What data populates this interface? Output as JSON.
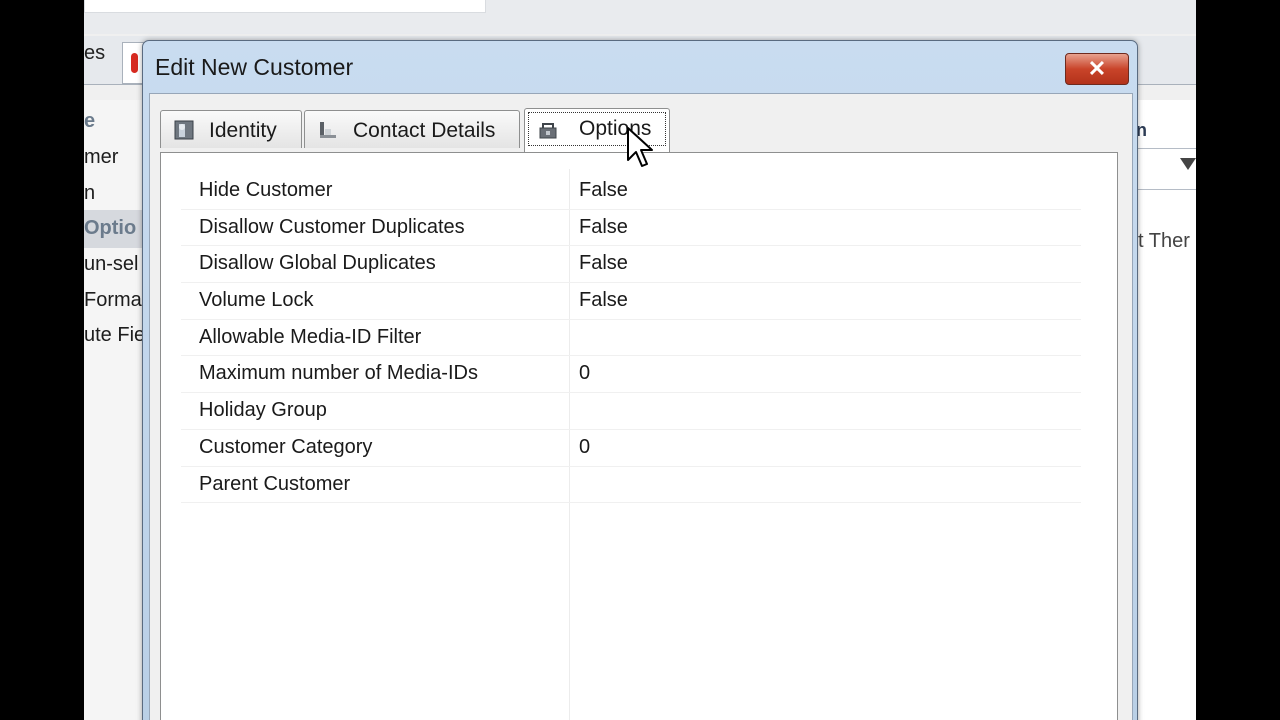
{
  "background_app": {
    "partial_tab_text": "es",
    "left_list": [
      {
        "text": "e",
        "header": true
      },
      {
        "text": "mer",
        "header": false
      },
      {
        "text": "n",
        "header": false
      },
      {
        "text": "Optio",
        "header": true
      },
      {
        "text": "un-sel",
        "header": false
      },
      {
        "text": "Forma",
        "header": false
      },
      {
        "text": "ute Fie",
        "header": false
      }
    ],
    "right_partial_text": "t Ther",
    "right_header_text": "n"
  },
  "dialog": {
    "title": "Edit New Customer",
    "close_label": "✕",
    "tabs": [
      {
        "label": "Identity",
        "icon": "identity-icon",
        "active": false
      },
      {
        "label": "Contact Details",
        "icon": "contact-details-icon",
        "active": false
      },
      {
        "label": "Options",
        "icon": "options-icon",
        "active": true
      }
    ],
    "properties": [
      {
        "name": "Hide Customer",
        "value": "False"
      },
      {
        "name": "Disallow Customer Duplicates",
        "value": "False"
      },
      {
        "name": "Disallow Global Duplicates",
        "value": "False"
      },
      {
        "name": "Volume Lock",
        "value": "False"
      },
      {
        "name": "Allowable Media-ID Filter",
        "value": ""
      },
      {
        "name": "Maximum number of Media-IDs",
        "value": "0"
      },
      {
        "name": "Holiday Group",
        "value": ""
      },
      {
        "name": "Customer Category",
        "value": "0"
      },
      {
        "name": "Parent Customer",
        "value": ""
      }
    ]
  },
  "colors": {
    "title_bar": "#c9dcf0",
    "close_button": "#c9442a",
    "panel": "#ffffff"
  }
}
